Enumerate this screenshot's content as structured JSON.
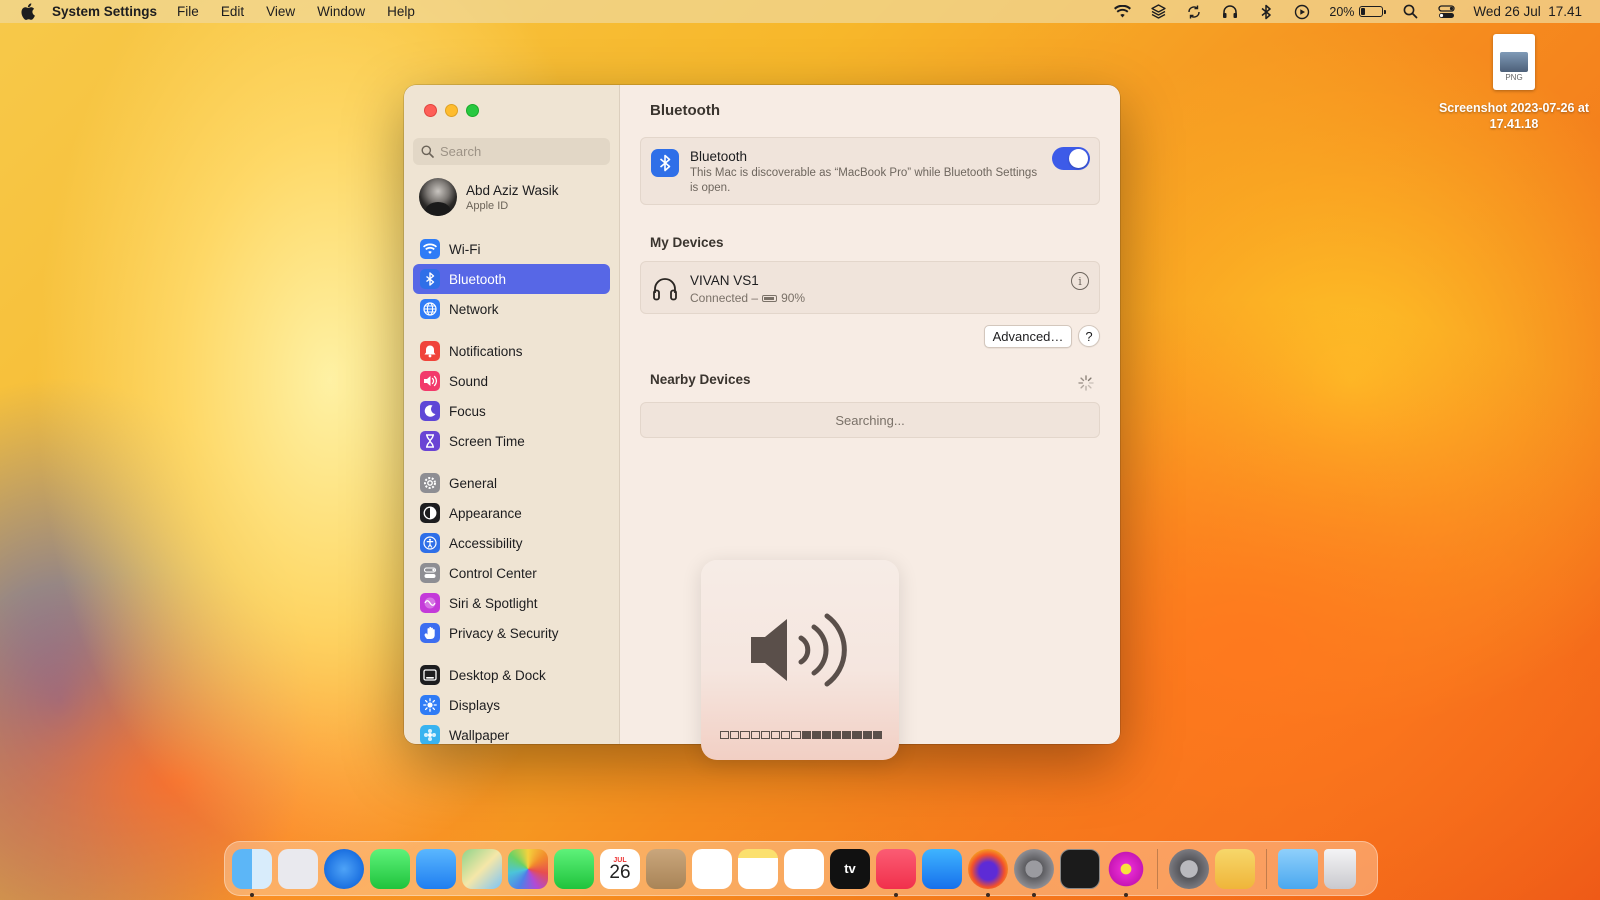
{
  "menubar": {
    "app_name": "System Settings",
    "menus": [
      "File",
      "Edit",
      "View",
      "Window",
      "Help"
    ],
    "battery_percent": "20%",
    "battery_level": 0.2,
    "clock": "Wed 26 Jul  17.41",
    "status_icons": [
      "wifi-icon",
      "layers-icon",
      "sync-icon",
      "headphones-icon",
      "bluetooth-icon",
      "play-icon",
      "battery-icon",
      "spotlight-icon",
      "control-center-icon"
    ]
  },
  "desktop_file": {
    "name": "Screenshot 2023-07-26 at 17.41.18",
    "ext": "PNG"
  },
  "sidebar": {
    "search_placeholder": "Search",
    "account_name": "Abd Aziz Wasik",
    "account_sub": "Apple ID",
    "groups": [
      [
        {
          "label": "Wi-Fi",
          "icon": "wifi-icon",
          "color": "#2f7cf6"
        },
        {
          "label": "Bluetooth",
          "icon": "bluetooth-icon",
          "color": "#2f6fe8",
          "active": true
        },
        {
          "label": "Network",
          "icon": "globe-icon",
          "color": "#2f7cf6"
        }
      ],
      [
        {
          "label": "Notifications",
          "icon": "bell-icon",
          "color": "#f0443a"
        },
        {
          "label": "Sound",
          "icon": "speaker-icon",
          "color": "#f23a6b"
        },
        {
          "label": "Focus",
          "icon": "moon-icon",
          "color": "#5e47d6"
        },
        {
          "label": "Screen Time",
          "icon": "hourglass-icon",
          "color": "#6a44d4"
        }
      ],
      [
        {
          "label": "General",
          "icon": "gear-icon",
          "color": "#8e8e93"
        },
        {
          "label": "Appearance",
          "icon": "appearance-icon",
          "color": "#1d1d1f"
        },
        {
          "label": "Accessibility",
          "icon": "accessibility-icon",
          "color": "#2f6fe8"
        },
        {
          "label": "Control Center",
          "icon": "control-center-icon",
          "color": "#8e8e93"
        },
        {
          "label": "Siri & Spotlight",
          "icon": "siri-icon",
          "color": "#c43ad9"
        },
        {
          "label": "Privacy & Security",
          "icon": "hand-icon",
          "color": "#3d6ef0"
        }
      ],
      [
        {
          "label": "Desktop & Dock",
          "icon": "dock-icon",
          "color": "#1d1d1f"
        },
        {
          "label": "Displays",
          "icon": "sun-icon",
          "color": "#2f7cf6"
        },
        {
          "label": "Wallpaper",
          "icon": "flower-icon",
          "color": "#39b3f0"
        }
      ]
    ]
  },
  "content": {
    "title": "Bluetooth",
    "bluetooth": {
      "label": "Bluetooth",
      "description": "This Mac is discoverable as “MacBook Pro” while Bluetooth Settings is open.",
      "enabled": true
    },
    "my_devices_label": "My Devices",
    "device": {
      "name": "VIVAN VS1",
      "status": "Connected –",
      "battery": "90%",
      "battery_level": 0.9
    },
    "advanced_label": "Advanced…",
    "help_label": "?",
    "nearby_label": "Nearby Devices",
    "searching_label": "Searching..."
  },
  "volume_hud": {
    "level": 0.5,
    "segments": 16
  },
  "dock": {
    "apps": [
      {
        "name": "finder-icon",
        "running": true
      },
      {
        "name": "launchpad-icon",
        "running": false
      },
      {
        "name": "safari-icon",
        "running": false
      },
      {
        "name": "messages-icon",
        "running": false
      },
      {
        "name": "mail-icon",
        "running": false
      },
      {
        "name": "maps-icon",
        "running": false
      },
      {
        "name": "photos-icon",
        "running": false
      },
      {
        "name": "facetime-icon",
        "running": false
      },
      {
        "name": "calendar-icon",
        "running": false,
        "month": "JUL",
        "day": "26"
      },
      {
        "name": "contacts-icon",
        "running": false
      },
      {
        "name": "reminders-icon",
        "running": false
      },
      {
        "name": "notes-icon",
        "running": false
      },
      {
        "name": "freeform-icon",
        "running": false
      },
      {
        "name": "tv-icon",
        "running": false,
        "text": "tv"
      },
      {
        "name": "music-icon",
        "running": true
      },
      {
        "name": "app-store-icon",
        "running": false
      },
      {
        "name": "firefox-icon",
        "running": true
      },
      {
        "name": "system-settings-icon",
        "running": true
      },
      {
        "name": "terminal-icon",
        "running": false
      },
      {
        "name": "flower-app-icon",
        "running": true
      }
    ],
    "extras": [
      {
        "name": "disk-utility-icon"
      },
      {
        "name": "recycle-icon"
      }
    ],
    "right": [
      {
        "name": "downloads-folder-icon"
      },
      {
        "name": "trash-icon"
      }
    ]
  }
}
